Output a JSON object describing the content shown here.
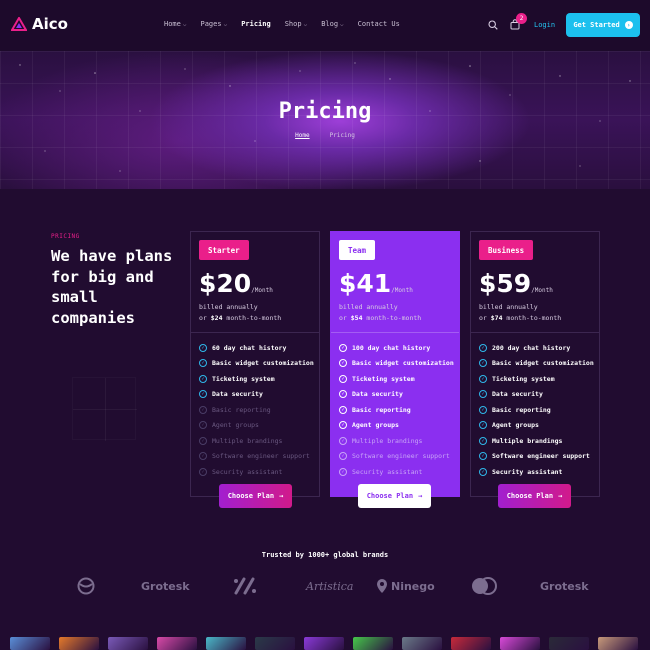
{
  "brand": {
    "name": "Aico",
    "accent": "#ea1f8a",
    "cyan": "#1cc0ee",
    "purple": "#8b2ff0"
  },
  "nav": {
    "items": [
      {
        "label": "Home",
        "dropdown": true
      },
      {
        "label": "Pages",
        "dropdown": true
      },
      {
        "label": "Pricing",
        "dropdown": false,
        "active": true
      },
      {
        "label": "Shop",
        "dropdown": true
      },
      {
        "label": "Blog",
        "dropdown": true
      },
      {
        "label": "Contact Us",
        "dropdown": false
      }
    ],
    "cart_count": "2",
    "login": "Login",
    "cta": "Get Started"
  },
  "hero": {
    "title": "Pricing",
    "breadcrumb": {
      "home": "Home",
      "current": "Pricing"
    }
  },
  "pricing": {
    "eyebrow": "PRICING",
    "heading": "We have plans for big and small companies",
    "plans": [
      {
        "name": "Starter",
        "price": "$20",
        "period": "/Month",
        "billed": "billed annually",
        "or_prefix": "or",
        "monthly": "$24",
        "or_suffix": "month-to-month",
        "features": [
          {
            "text": "60 day chat history",
            "included": true
          },
          {
            "text": "Basic widget customization",
            "included": true
          },
          {
            "text": "Ticketing system",
            "included": true
          },
          {
            "text": "Data security",
            "included": true
          },
          {
            "text": "Basic reporting",
            "included": false
          },
          {
            "text": "Agent groups",
            "included": false
          },
          {
            "text": "Multiple brandings",
            "included": false
          },
          {
            "text": "Software engineer support",
            "included": false
          },
          {
            "text": "Security assistant",
            "included": false
          }
        ],
        "button": "Choose Plan"
      },
      {
        "name": "Team",
        "price": "$41",
        "period": "/Month",
        "billed": "billed annually",
        "or_prefix": "or",
        "monthly": "$54",
        "or_suffix": "month-to-month",
        "features": [
          {
            "text": "100 day chat history",
            "included": true
          },
          {
            "text": "Basic widget customization",
            "included": true
          },
          {
            "text": "Ticketing system",
            "included": true
          },
          {
            "text": "Data security",
            "included": true
          },
          {
            "text": "Basic reporting",
            "included": true
          },
          {
            "text": "Agent groups",
            "included": true
          },
          {
            "text": "Multiple brandings",
            "included": false
          },
          {
            "text": "Software engineer support",
            "included": false
          },
          {
            "text": "Security assistant",
            "included": false
          }
        ],
        "button": "Choose Plan"
      },
      {
        "name": "Business",
        "price": "$59",
        "period": "/Month",
        "billed": "billed annually",
        "or_prefix": "or",
        "monthly": "$74",
        "or_suffix": "month-to-month",
        "features": [
          {
            "text": "200 day chat history",
            "included": true
          },
          {
            "text": "Basic widget customization",
            "included": true
          },
          {
            "text": "Ticketing system",
            "included": true
          },
          {
            "text": "Data security",
            "included": true
          },
          {
            "text": "Basic reporting",
            "included": true
          },
          {
            "text": "Agent groups",
            "included": true
          },
          {
            "text": "Multiple brandings",
            "included": true
          },
          {
            "text": "Software engineer support",
            "included": true
          },
          {
            "text": "Security assistant",
            "included": true
          }
        ],
        "button": "Choose Plan"
      }
    ]
  },
  "brands": {
    "title": "Trusted by 1000+ global brands",
    "logos": [
      {
        "name": "circle-logo",
        "label": ""
      },
      {
        "name": "grotesk-logo",
        "label": "Grotesk"
      },
      {
        "name": "slash-logo",
        "label": ""
      },
      {
        "name": "artistica-logo",
        "label": "Artistica"
      },
      {
        "name": "ninego-logo",
        "label": "Ninego"
      },
      {
        "name": "rings-logo",
        "label": ""
      },
      {
        "name": "grotesk-logo-2",
        "label": "Grotesk"
      }
    ]
  },
  "gallery": {
    "thumb_colors": [
      "#5a8fd8",
      "#e57a2a",
      "#7a5ab8",
      "#d84aa8",
      "#4ab8c8",
      "#2a3a48",
      "#8a3ad8",
      "#46c84a",
      "#6a7a88",
      "#c82a3a",
      "#d84ad8",
      "#2a2a38",
      "#c89a7a"
    ]
  }
}
